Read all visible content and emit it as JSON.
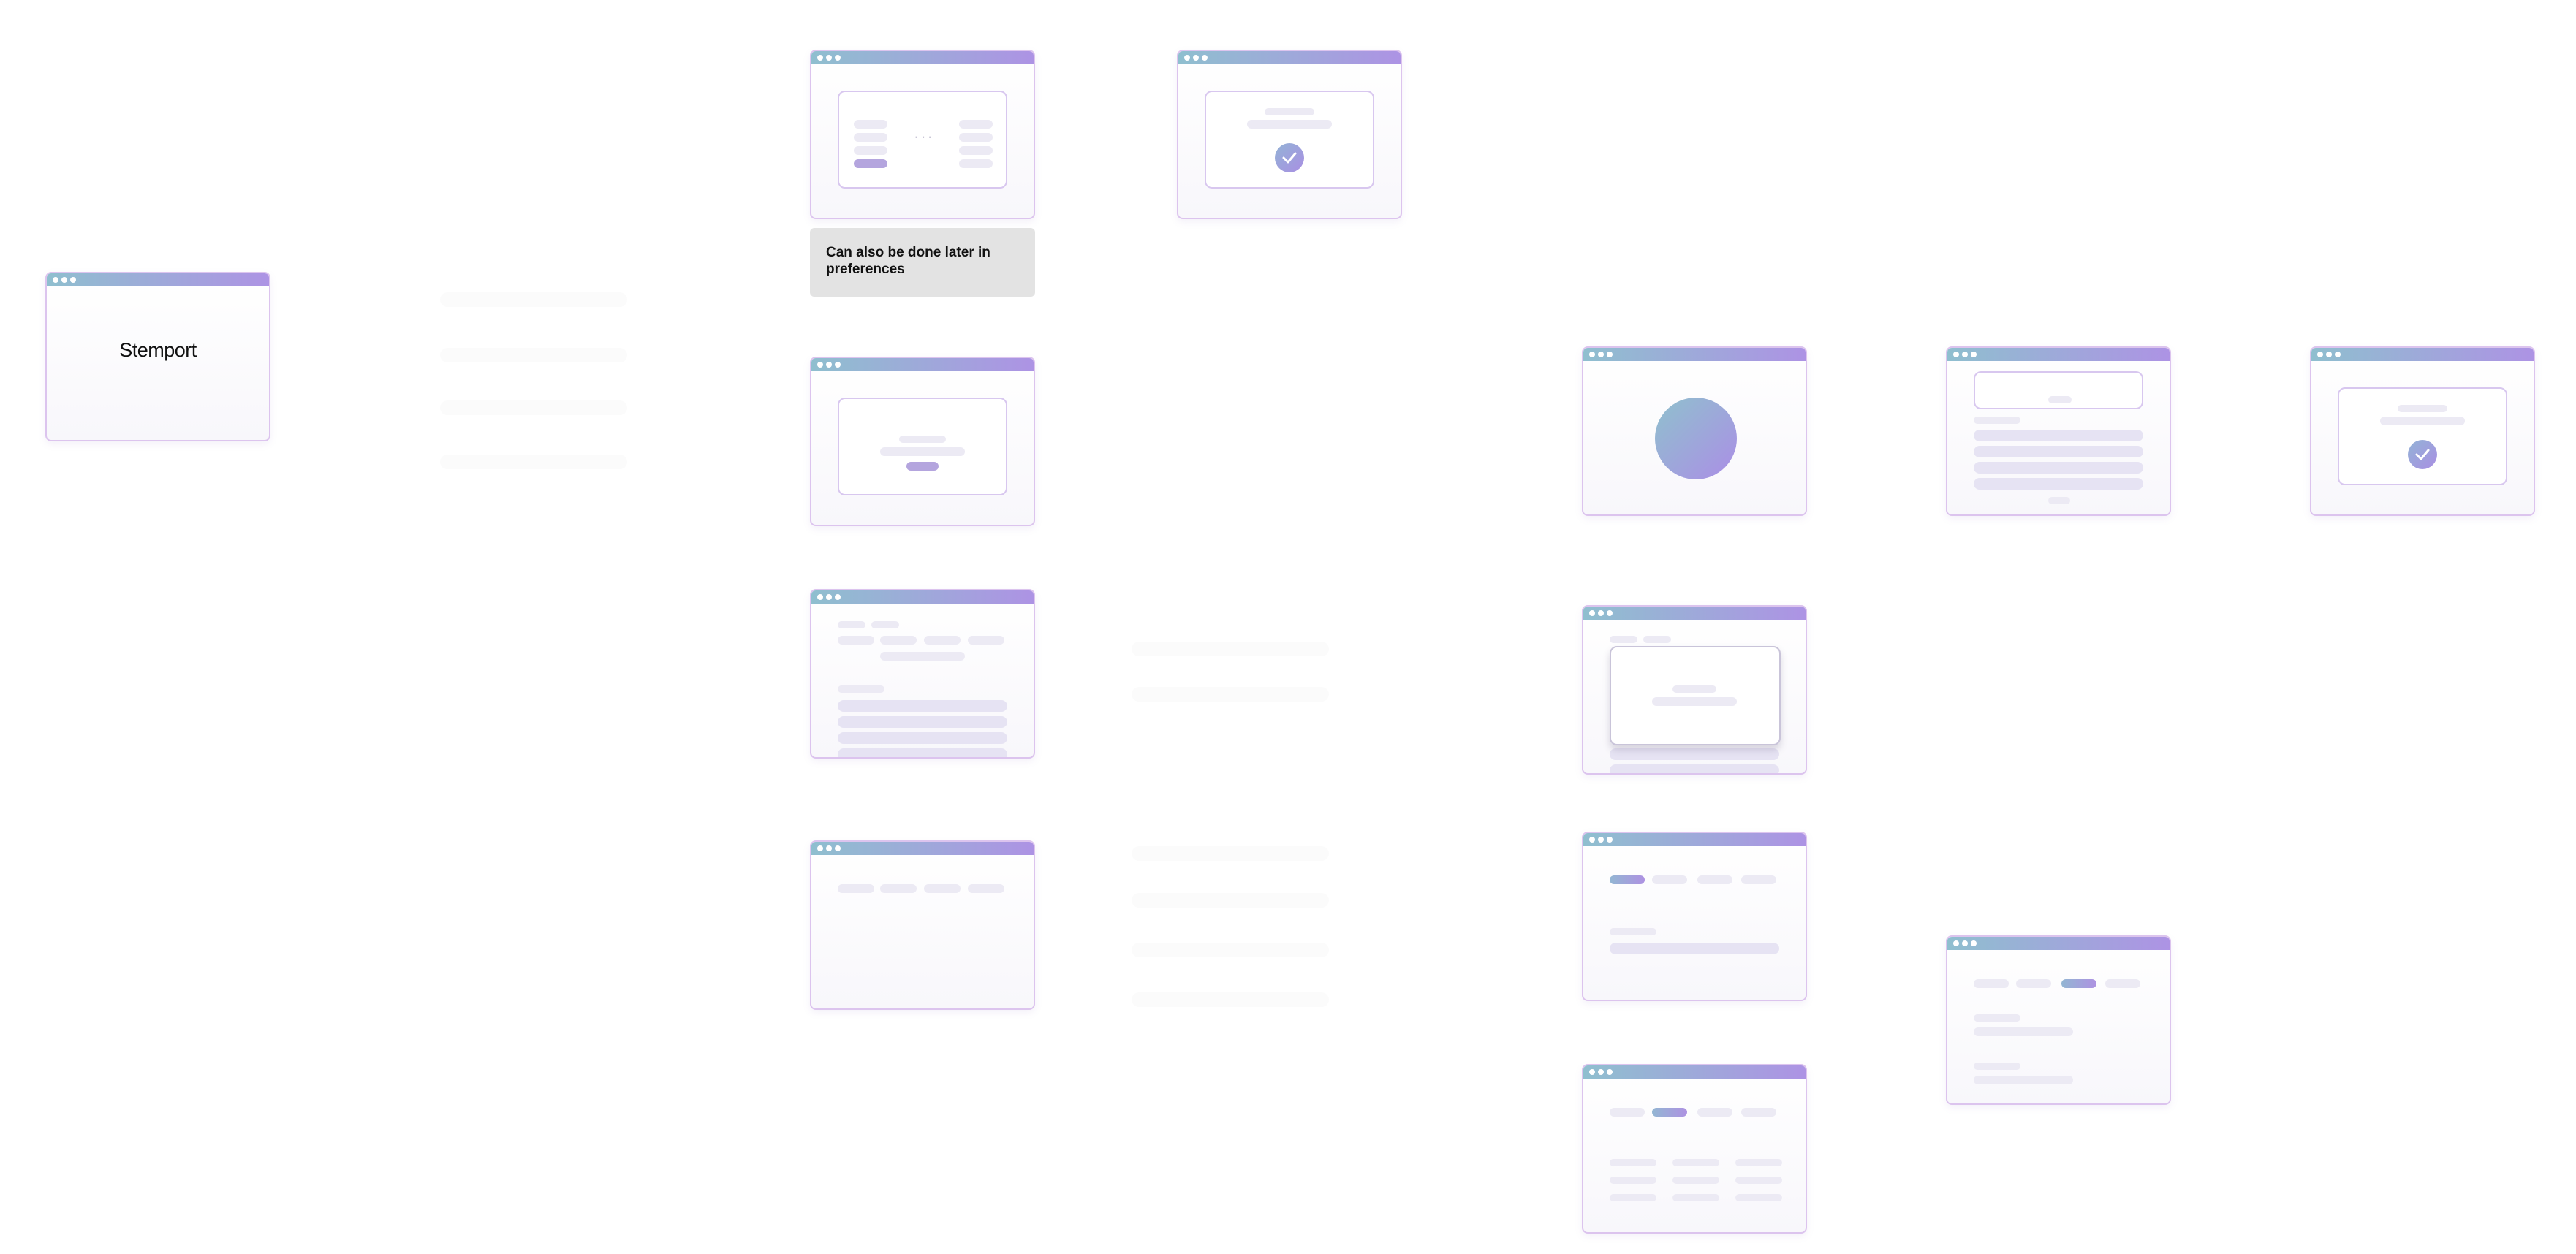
{
  "app_title": "Stemport",
  "note_text": "Can also be done later in preferences",
  "colors": {
    "window_bar_start": "#8fbfcf",
    "window_bar_end": "#ad93e4",
    "frame_border": "#dcc4ee",
    "note_background": "#e3e3e3",
    "placeholder": "#eceaf4"
  },
  "icons": {
    "check": "check-icon",
    "window_controls": "window-dots-icon",
    "ellipsis": "ellipsis-icon"
  },
  "ellipsis": "···"
}
